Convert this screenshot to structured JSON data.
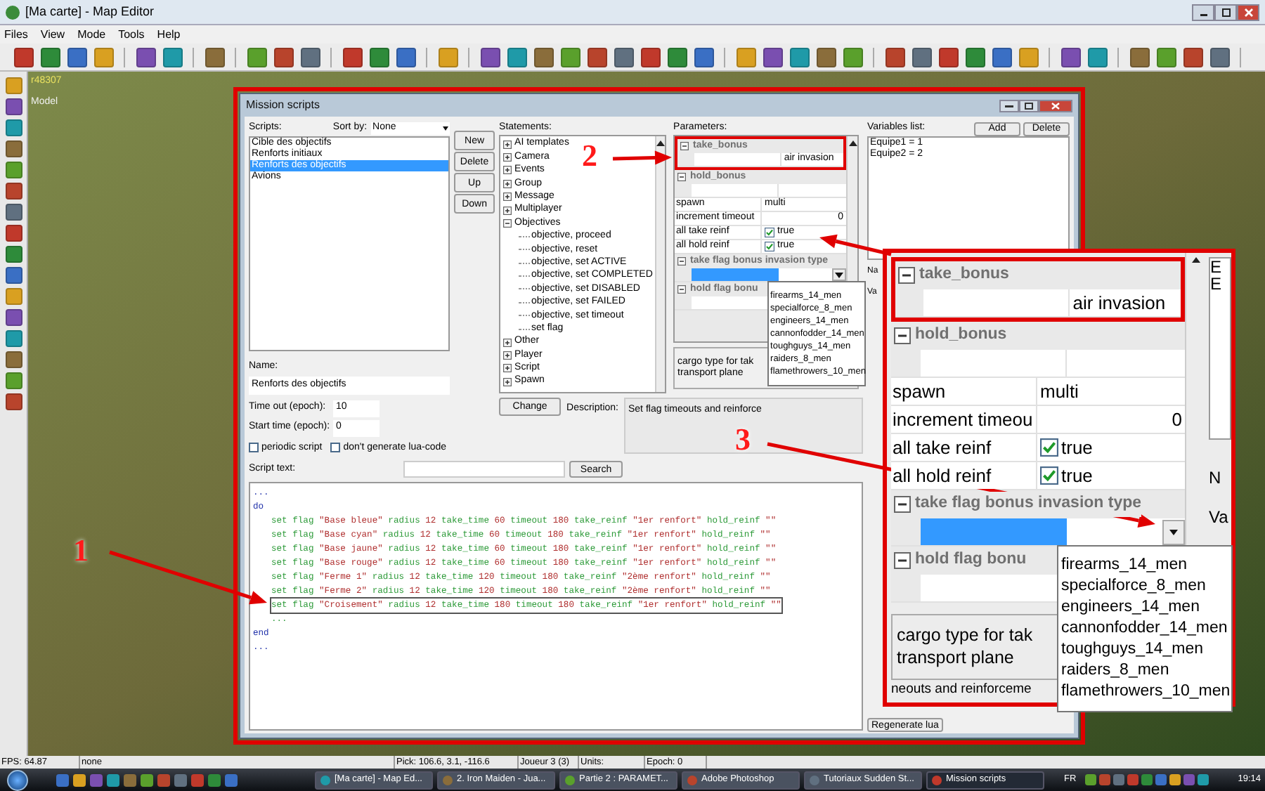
{
  "app": {
    "title": "[Ma carte] - Map Editor"
  },
  "menu": [
    "Files",
    "View",
    "Mode",
    "Tools",
    "Help"
  ],
  "map_overlay": {
    "coords": "r48307",
    "model": "Model"
  },
  "dialog": {
    "title": "Mission scripts",
    "scripts": {
      "label": "Scripts:",
      "sort_label": "Sort by:",
      "sort_value": "None",
      "items": [
        {
          "label": "Cible des objectifs",
          "selected": false
        },
        {
          "label": "Renforts initiaux",
          "selected": false
        },
        {
          "label": "Renforts des objectifs",
          "selected": true
        },
        {
          "label": "Avions",
          "selected": false
        }
      ]
    },
    "script_buttons": [
      "New",
      "Delete",
      "Up",
      "Down"
    ],
    "name": {
      "label": "Name:",
      "value": "Renforts des objectifs"
    },
    "timeout": {
      "label": "Time out (epoch):",
      "value": "10"
    },
    "start_time": {
      "label": "Start time (epoch):",
      "value": "0"
    },
    "options": [
      {
        "label": "periodic script",
        "checked": false
      },
      {
        "label": "don't generate lua-code",
        "checked": false
      }
    ],
    "statements": {
      "label": "Statements:",
      "tree": [
        {
          "label": "AI templates",
          "expanded": false
        },
        {
          "label": "Camera",
          "expanded": false
        },
        {
          "label": "Events",
          "expanded": false
        },
        {
          "label": "Group",
          "expanded": false
        },
        {
          "label": "Message",
          "expanded": false
        },
        {
          "label": "Multiplayer",
          "expanded": false
        },
        {
          "label": "Objectives",
          "expanded": true,
          "children": [
            {
              "label": "objective, proceed"
            },
            {
              "label": "objective, reset"
            },
            {
              "label": "objective, set ACTIVE"
            },
            {
              "label": "objective, set COMPLETED"
            },
            {
              "label": "objective, set DISABLED"
            },
            {
              "label": "objective, set FAILED"
            },
            {
              "label": "objective, set timeout"
            },
            {
              "label": "set flag"
            }
          ]
        },
        {
          "label": "Other",
          "expanded": false
        },
        {
          "label": "Player",
          "expanded": false
        },
        {
          "label": "Script",
          "expanded": false
        },
        {
          "label": "Spawn",
          "expanded": false
        }
      ]
    },
    "change_button": "Change",
    "description": {
      "label": "Description:",
      "text": "Set flag timeouts and reinforce"
    },
    "parameters": {
      "label": "Parameters:",
      "groups": [
        {
          "label": "take_bonus",
          "expanded": true,
          "highlighted": true,
          "rows": [
            {
              "kind": "value",
              "value": "air invasion"
            }
          ]
        },
        {
          "label": "hold_bonus",
          "expanded": true,
          "highlighted": false,
          "rows": [
            {
              "kind": "blank"
            },
            {
              "kind": "value",
              "name": "spawn",
              "value": "multi"
            },
            {
              "kind": "number",
              "name": "increment timeout",
              "value": "0"
            },
            {
              "kind": "check",
              "name": "all take reinf",
              "checked": true,
              "value": "true"
            },
            {
              "kind": "check",
              "name": "all hold reinf",
              "checked": true,
              "value": "true"
            }
          ]
        },
        {
          "label": "take flag bonus invasion type",
          "expanded": true,
          "highlighted": false,
          "rows": [
            {
              "kind": "select",
              "selected": true
            }
          ]
        },
        {
          "label": "hold flag bonu",
          "expanded": true,
          "highlighted": false,
          "rows": [
            {
              "kind": "blank"
            }
          ]
        }
      ],
      "dropdown_options": [
        "firearms_14_men",
        "specialforce_8_men",
        "engineers_14_men",
        "cannonfodder_14_men",
        "toughguys_14_men",
        "raiders_8_men",
        "flamethrowers_10_men"
      ],
      "help_lines": [
        "cargo type for tak",
        "transport plane"
      ]
    },
    "variables": {
      "label": "Variables list:",
      "buttons": [
        "Add",
        "Delete"
      ],
      "items": [
        "Equipe1 = 1",
        "Equipe2 = 2"
      ]
    },
    "side_labels": [
      "Na",
      "Va"
    ],
    "regenerate_button": "Regenerate lua",
    "script_text": {
      "label": "Script text:",
      "search_button": "Search",
      "lines": [
        {
          "kind": "keyword",
          "text": "...",
          "selected": false
        },
        {
          "kind": "keyword",
          "text": "do",
          "selected": false
        },
        {
          "kind": "statement",
          "text": "set flag \"Base bleue\" radius 12 take_time 60 timeout 180 take_reinf \"1er renfort\" hold_reinf \"\"",
          "selected": false
        },
        {
          "kind": "statement",
          "text": "set flag \"Base cyan\" radius 12 take_time 60 timeout 180 take_reinf \"1er renfort\" hold_reinf \"\"",
          "selected": false
        },
        {
          "kind": "statement",
          "text": "set flag \"Base jaune\" radius 12 take_time 60 timeout 180 take_reinf \"1er renfort\" hold_reinf \"\"",
          "selected": false
        },
        {
          "kind": "statement",
          "text": "set flag \"Base rouge\" radius 12 take_time 60 timeout 180 take_reinf \"1er renfort\" hold_reinf \"\"",
          "selected": false
        },
        {
          "kind": "statement",
          "text": "set flag \"Ferme 1\" radius 12 take_time 120 timeout 180 take_reinf \"2ème renfort\" hold_reinf \"\"",
          "selected": false
        },
        {
          "kind": "statement",
          "text": "set flag \"Ferme 2\" radius 12 take_time 120 timeout 180 take_reinf \"2ème renfort\" hold_reinf \"\"",
          "selected": false
        },
        {
          "kind": "statement",
          "text": "set flag \"Croisement\" radius 12 take_time 180 timeout 180 take_reinf \"1er renfort\" hold_reinf \"\"",
          "selected": true
        },
        {
          "kind": "statement",
          "text": "...",
          "selected": false
        },
        {
          "kind": "keyword",
          "text": "end",
          "selected": false
        },
        {
          "kind": "keyword",
          "text": "...",
          "selected": false
        }
      ]
    }
  },
  "zoom_inset": {
    "groups": [
      {
        "label": "take_bonus",
        "expanded": true,
        "highlighted": true,
        "rows": [
          {
            "kind": "value",
            "value": "air invasion"
          }
        ]
      },
      {
        "label": "hold_bonus",
        "expanded": true,
        "highlighted": false,
        "rows": [
          {
            "kind": "blank"
          },
          {
            "kind": "value",
            "name": "spawn",
            "value": "multi"
          },
          {
            "kind": "number",
            "name": "increment timeou",
            "value": "0"
          },
          {
            "kind": "check",
            "name": "all take reinf",
            "checked": true,
            "value": "true"
          },
          {
            "kind": "check",
            "name": "all hold reinf",
            "checked": true,
            "value": "true"
          }
        ]
      },
      {
        "label": "take flag bonus invasion type",
        "expanded": true,
        "highlighted": false,
        "rows": [
          {
            "kind": "select",
            "selected": true
          }
        ]
      },
      {
        "label": "hold flag bonu",
        "expanded": true,
        "highlighted": false,
        "rows": [
          {
            "kind": "blank"
          }
        ]
      }
    ],
    "dropdown_options": [
      "firearms_14_men",
      "specialforce_8_men",
      "engineers_14_men",
      "cannonfodder_14_men",
      "toughguys_14_men",
      "raiders_8_men",
      "flamethrowers_10_men"
    ],
    "help_lines": [
      "cargo type for tak",
      "transport plane"
    ],
    "footer": "neouts and reinforceme",
    "side_items": [
      "E",
      "E"
    ],
    "side_labels": [
      "N",
      "Va"
    ]
  },
  "callouts": [
    {
      "label": "1"
    },
    {
      "label": "2"
    },
    {
      "label": "3"
    }
  ],
  "status_bar": [
    "FPS: 64.87",
    "none",
    "Pick: 106.6, 3.1, -116.6",
    "Joueur 3 (3)",
    "Units:",
    "Epoch: 0"
  ],
  "taskbar": {
    "items": [
      {
        "label": "[Ma carte] - Map Ed...",
        "selected": false
      },
      {
        "label": "2. Iron Maiden - Jua...",
        "selected": false
      },
      {
        "label": "Partie 2 : PARAMET...",
        "selected": false
      },
      {
        "label": "Adobe Photoshop",
        "selected": false
      },
      {
        "label": "Tutoriaux Sudden St...",
        "selected": false
      },
      {
        "label": "Mission scripts",
        "selected": true
      }
    ],
    "language": "FR",
    "time": "19:14"
  }
}
